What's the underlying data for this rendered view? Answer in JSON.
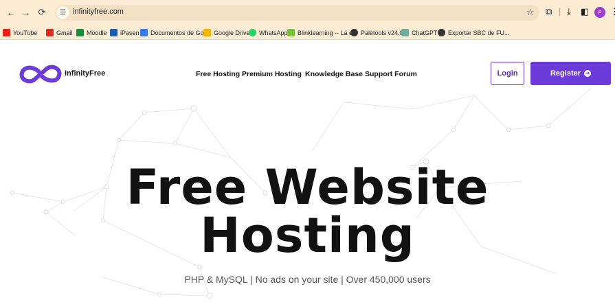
{
  "browser": {
    "url": "infinityfree.com",
    "profile_initial": "P",
    "bookmarks": [
      {
        "label": "YouTube",
        "color": "#e62117"
      },
      {
        "label": "Gmail",
        "color": "#d93025"
      },
      {
        "label": "Moodle",
        "color": "#1b8a3a"
      },
      {
        "label": "iPasen",
        "color": "#1e5aa8"
      },
      {
        "label": "Documentos de Go...",
        "color": "#3b78e7"
      },
      {
        "label": "Google Drive",
        "color": "#f4b400"
      },
      {
        "label": "WhatsApp",
        "color": "#25d366"
      },
      {
        "label": "Blinklearning -- La e...",
        "color": "#7cc242"
      },
      {
        "label": "Paletools v24.0.1",
        "color": "#333333"
      },
      {
        "label": "ChatGPT",
        "color": "#74aa9c"
      },
      {
        "label": "Exportar SBC de FU...",
        "color": "#333333"
      }
    ]
  },
  "site": {
    "brand": "InfinityFree",
    "brand_color": "#6c3bd9",
    "nav": [
      "Free Hosting",
      "Premium Hosting",
      "Knowledge Base",
      "Support Forum"
    ],
    "login_label": "Login",
    "register_label": "Register",
    "hero_line1": "Free Website",
    "hero_line2": "Hosting",
    "subtitle": "PHP & MySQL | No ads on your site | Over 450,000 users"
  }
}
